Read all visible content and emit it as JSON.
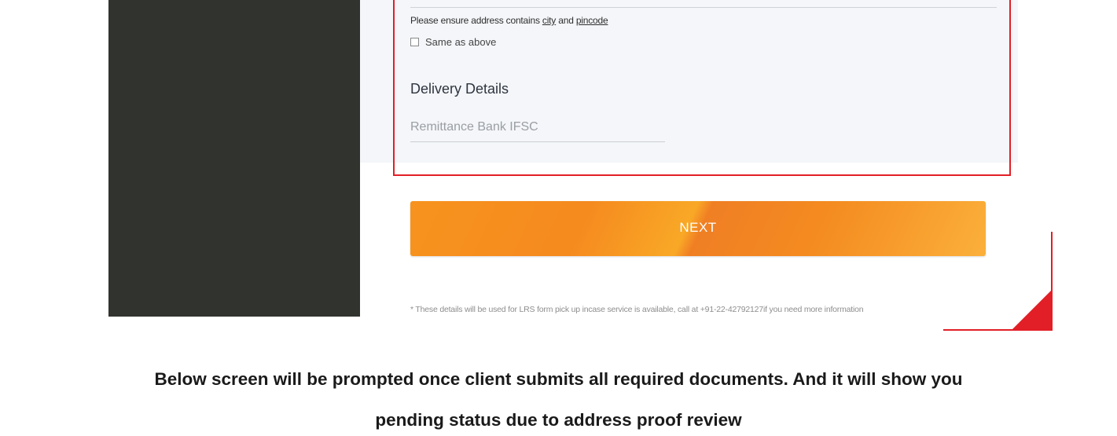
{
  "form": {
    "hint_prefix": "Please ensure address contains ",
    "hint_city": "city",
    "hint_and": " and ",
    "hint_pincode": "pincode",
    "same_as_above_label": "Same as above",
    "same_as_above_checked": false,
    "delivery_title": "Delivery Details",
    "ifsc_placeholder": "Remittance Bank IFSC",
    "next_label": "NEXT",
    "disclaimer": "* These details will be used for LRS form pick up incase service is available, call at +91-22-42792127if you need more information"
  },
  "caption": {
    "line1": "Below screen will be prompted once client submits all required documents. And it will show you",
    "line2": "pending status due to address proof review"
  },
  "colors": {
    "accent_red": "#e21e26",
    "button_orange": "#f58a1f",
    "dark_panel": "#31332f"
  }
}
